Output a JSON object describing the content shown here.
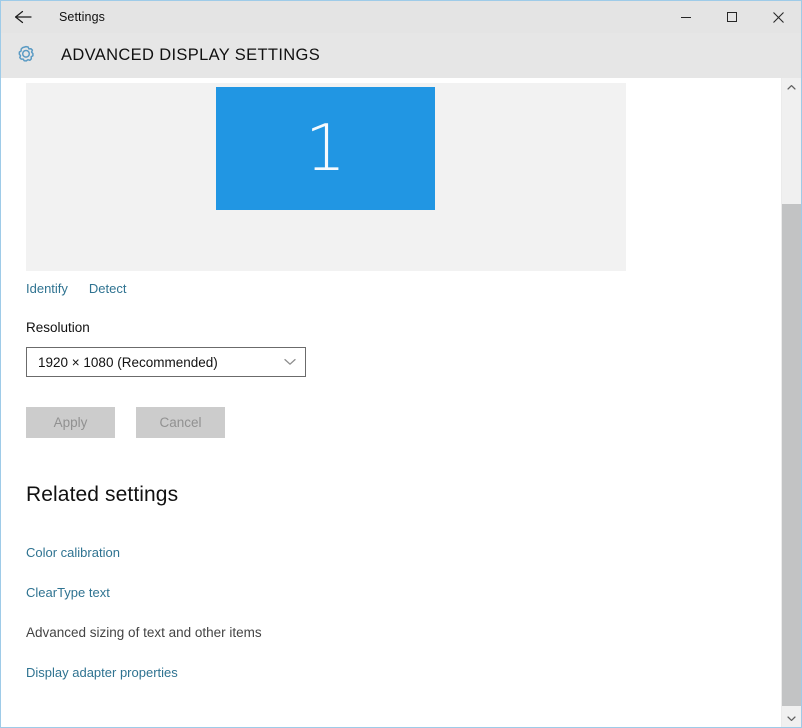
{
  "window": {
    "title": "Settings",
    "back_icon": "back-arrow-icon",
    "controls": {
      "minimize": "minimize-icon",
      "maximize": "maximize-icon",
      "close": "close-icon"
    }
  },
  "header": {
    "icon": "gear-icon",
    "title": "ADVANCED DISPLAY SETTINGS"
  },
  "display_preview": {
    "monitor_number": "1",
    "monitor_color": "#2196e3",
    "panel_color": "#f2f2f2",
    "actions": [
      {
        "label": "Identify",
        "name": "identify-link"
      },
      {
        "label": "Detect",
        "name": "detect-link"
      }
    ]
  },
  "resolution": {
    "label": "Resolution",
    "selected": "1920 × 1080 (Recommended)",
    "dropdown_icon": "chevron-down-icon"
  },
  "buttons": {
    "apply": "Apply",
    "cancel": "Cancel",
    "disabled": true
  },
  "related_settings": {
    "heading": "Related settings",
    "items": [
      {
        "label": "Color calibration",
        "type": "link",
        "name": "color-calibration-link"
      },
      {
        "label": "ClearType text",
        "type": "link",
        "name": "cleartype-text-link"
      },
      {
        "label": "Advanced sizing of text and other items",
        "type": "text",
        "name": "advanced-sizing-text"
      },
      {
        "label": "Display adapter properties",
        "type": "link",
        "name": "display-adapter-properties-link"
      }
    ]
  },
  "scrollbar": {
    "up_icon": "scroll-up-arrow-icon",
    "down_icon": "scroll-down-arrow-icon"
  },
  "colors": {
    "link": "#2f7391",
    "accent_blue": "#2196e3",
    "titlebar": "#e4e4e4",
    "header_band": "#e6e6e6"
  }
}
